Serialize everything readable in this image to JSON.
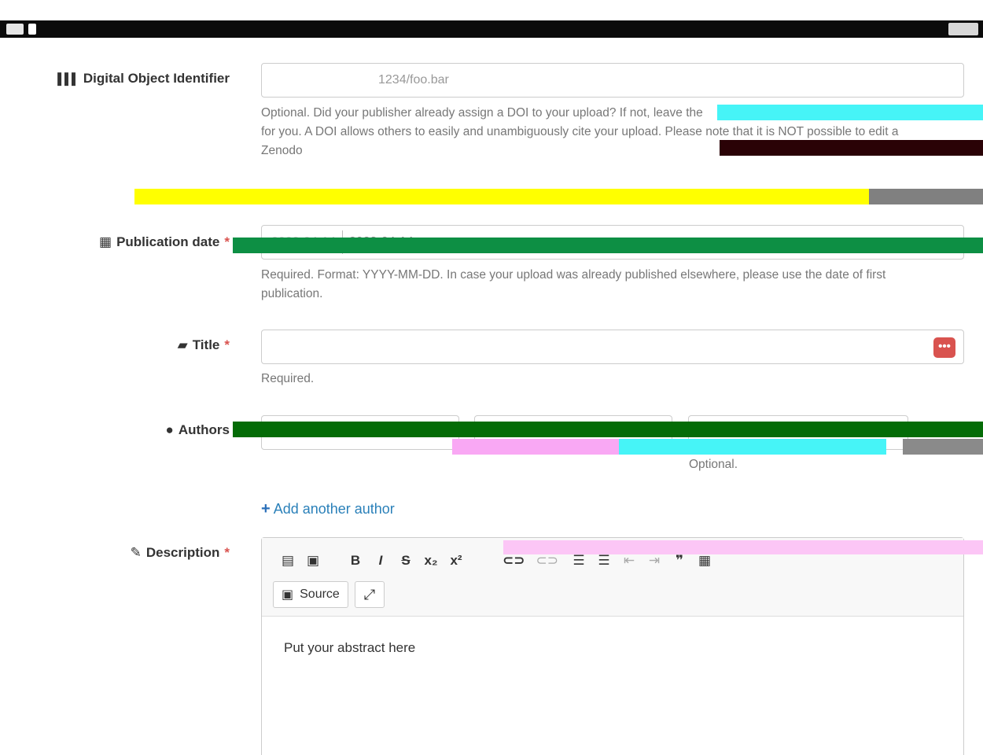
{
  "doi": {
    "label": "Digital Object Identifier",
    "placeholder": "1234/foo.bar",
    "help_line1": "Optional. Did your publisher already assign a DOI to your upload? If not, leave the",
    "help_line2": "for you. A DOI allows others to easily and unambiguously cite your upload. Please note that it is NOT possible to edit a",
    "help_line3": "Zenodo"
  },
  "publication_date": {
    "label": "Publication date",
    "required_mark": "*",
    "value_a": "2023-04-14",
    "value_b": "2023-04-14",
    "help_line1": "Required. Format: YYYY-MM-DD. In case your upload was already published elsewhere, please use the date of first",
    "help_line2": "publication."
  },
  "title": {
    "label": "Title",
    "required_mark": "*",
    "help": "Required.",
    "dots": "•••"
  },
  "authors": {
    "label": "Authors",
    "help": "Optional.",
    "add_link": "Add another author"
  },
  "description": {
    "label": "Description",
    "required_mark": "*",
    "source_label": "Source",
    "body": "Put your abstract here",
    "toolbar": [
      "B",
      "I",
      "S",
      "x₂",
      "x²"
    ]
  },
  "colors": {
    "required": "#d9534f",
    "link": "#2a80b9"
  }
}
